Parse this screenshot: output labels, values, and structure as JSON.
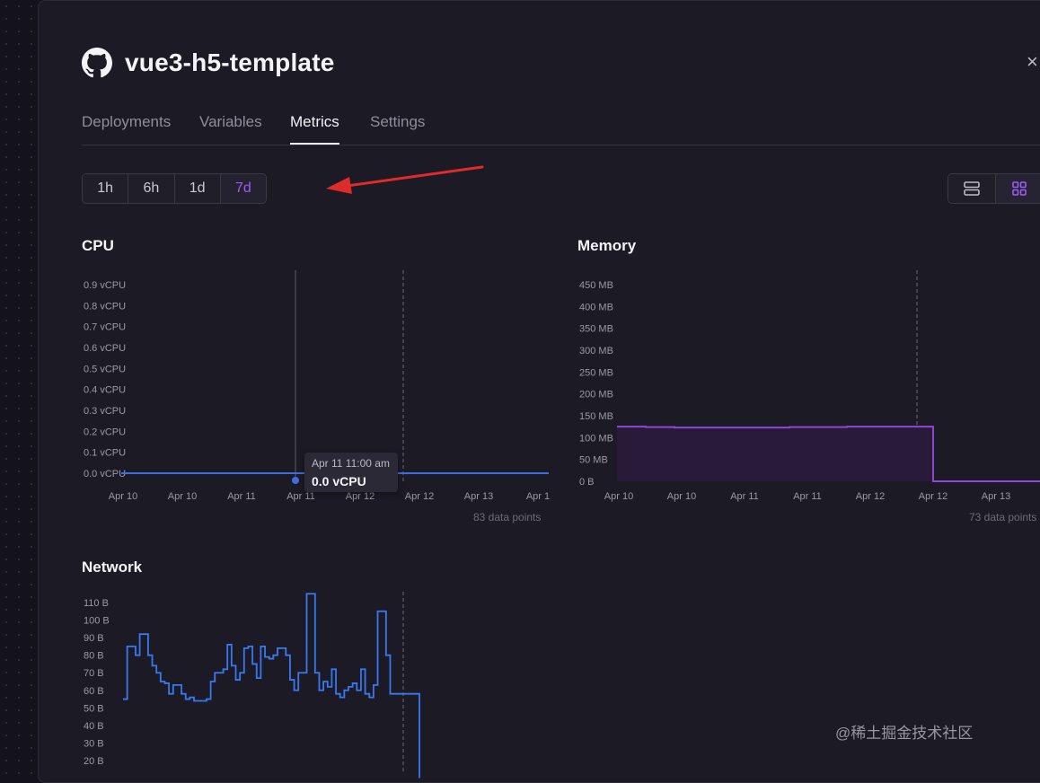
{
  "header": {
    "title": "vue3-h5-template",
    "close_glyph": "×"
  },
  "tabs": [
    {
      "label": "Deployments",
      "active": false
    },
    {
      "label": "Variables",
      "active": false
    },
    {
      "label": "Metrics",
      "active": true
    },
    {
      "label": "Settings",
      "active": false
    }
  ],
  "time_range": {
    "options": [
      "1h",
      "6h",
      "1d",
      "7d"
    ],
    "selected": "7d"
  },
  "layout_toggle": {
    "options": [
      "rows-icon",
      "grid-icon"
    ],
    "selected": "grid-icon"
  },
  "colors": {
    "accent": "#9b5cf2",
    "cpu_line": "#3b6fe0",
    "memory_line": "#8e45d8",
    "network_line": "#3a78f0",
    "arrow": "#e02b2b"
  },
  "cpu": {
    "title": "CPU",
    "points_label": "83 data points",
    "tooltip": {
      "date": "Apr 11 11:00 am",
      "value": "0.0 vCPU"
    }
  },
  "memory": {
    "title": "Memory",
    "points_label": "73 data points"
  },
  "network": {
    "title": "Network"
  },
  "watermark": "@稀土掘金技术社区",
  "chart_data": [
    {
      "type": "line",
      "title": "CPU",
      "y_ticks": [
        "0.9 vCPU",
        "0.8 vCPU",
        "0.7 vCPU",
        "0.6 vCPU",
        "0.5 vCPU",
        "0.4 vCPU",
        "0.3 vCPU",
        "0.2 vCPU",
        "0.1 vCPU",
        "0.0 vCPU"
      ],
      "x_ticks": [
        "Apr 10",
        "Apr 10",
        "Apr 11",
        "Apr 11",
        "Apr 12",
        "Apr 12",
        "Apr 13",
        "Apr 1"
      ],
      "ylim": [
        0,
        0.9
      ],
      "series": [
        {
          "values": [
            0,
            0,
            0,
            0,
            0,
            0,
            0,
            0,
            0,
            0,
            0,
            0
          ]
        }
      ]
    },
    {
      "type": "area",
      "title": "Memory",
      "y_ticks": [
        "450 MB",
        "400 MB",
        "350 MB",
        "300 MB",
        "250 MB",
        "200 MB",
        "150 MB",
        "100 MB",
        "50 MB",
        "0 B"
      ],
      "x_ticks": [
        "Apr 10",
        "Apr 10",
        "Apr 11",
        "Apr 11",
        "Apr 12",
        "Apr 12",
        "Apr 13"
      ],
      "ylim": [
        0,
        450
      ],
      "series": [
        {
          "values": [
            125,
            124,
            123,
            123,
            123,
            123,
            124,
            124,
            125,
            125,
            125,
            0,
            0,
            0,
            0,
            0,
            0
          ]
        }
      ]
    },
    {
      "type": "line",
      "title": "Network",
      "y_ticks": [
        "110 B",
        "100 B",
        "90 B",
        "80 B",
        "70 B",
        "60 B",
        "50 B",
        "40 B",
        "30 B",
        "20 B"
      ],
      "ylim": [
        20,
        110
      ],
      "series": [
        {
          "values": [
            55,
            85,
            85,
            80,
            92,
            92,
            80,
            74,
            70,
            65,
            64,
            58,
            63,
            63,
            58,
            55,
            56,
            54,
            54,
            54,
            55,
            65,
            70,
            70,
            72,
            86,
            74,
            66,
            70,
            84,
            85,
            75,
            67,
            85,
            79,
            78,
            80,
            84,
            84,
            80,
            66,
            60,
            70,
            70,
            115,
            115,
            70,
            60,
            65,
            62,
            72,
            58,
            56,
            60,
            62,
            64,
            60,
            72,
            58,
            56,
            63,
            105,
            105,
            80,
            58,
            58,
            58,
            58,
            58,
            58,
            58,
            10
          ]
        }
      ]
    }
  ]
}
